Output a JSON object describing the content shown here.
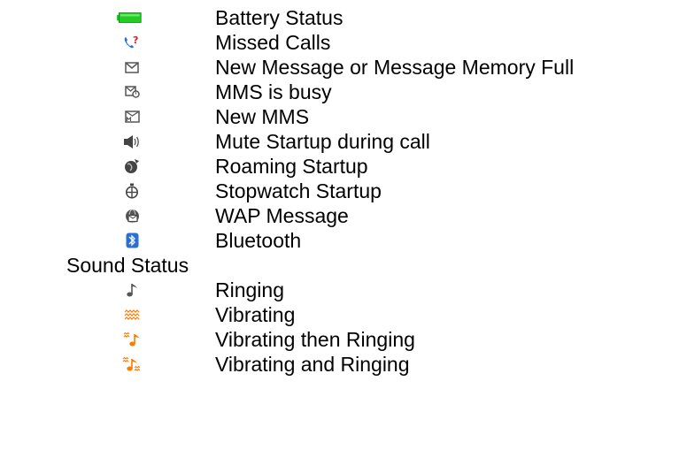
{
  "items": [
    {
      "label": "Battery Status",
      "icon": "battery-full-icon"
    },
    {
      "label": "Missed Calls",
      "icon": "missed-call-icon"
    },
    {
      "label": "New Message or Message Memory Full",
      "icon": "envelope-icon"
    },
    {
      "label": "MMS is busy",
      "icon": "mms-busy-icon"
    },
    {
      "label": "New MMS",
      "icon": "new-mms-icon"
    },
    {
      "label": "Mute Startup during call",
      "icon": "mute-speaker-icon"
    },
    {
      "label": "Roaming Startup",
      "icon": "roaming-icon"
    },
    {
      "label": "Stopwatch Startup",
      "icon": "stopwatch-icon"
    },
    {
      "label": "WAP Message",
      "icon": "wap-message-icon"
    },
    {
      "label": "Bluetooth",
      "icon": "bluetooth-icon"
    }
  ],
  "sound_section": {
    "title": "Sound Status",
    "items": [
      {
        "label": "Ringing",
        "icon": "music-note-icon"
      },
      {
        "label": "Vibrating",
        "icon": "vibrate-icon"
      },
      {
        "label": "Vibrating then Ringing",
        "icon": "vibrate-then-ring-icon"
      },
      {
        "label": "Vibrating and Ringing",
        "icon": "vibrate-and-ring-icon"
      }
    ]
  },
  "colors": {
    "battery": "#22cc22",
    "missed_call_phone": "#2a6fd6",
    "missed_call_mark": "#e02020",
    "bluetooth_bg": "#2a6fd6",
    "sound_orange": "#ff7a00",
    "gray_icon": "#555555"
  }
}
